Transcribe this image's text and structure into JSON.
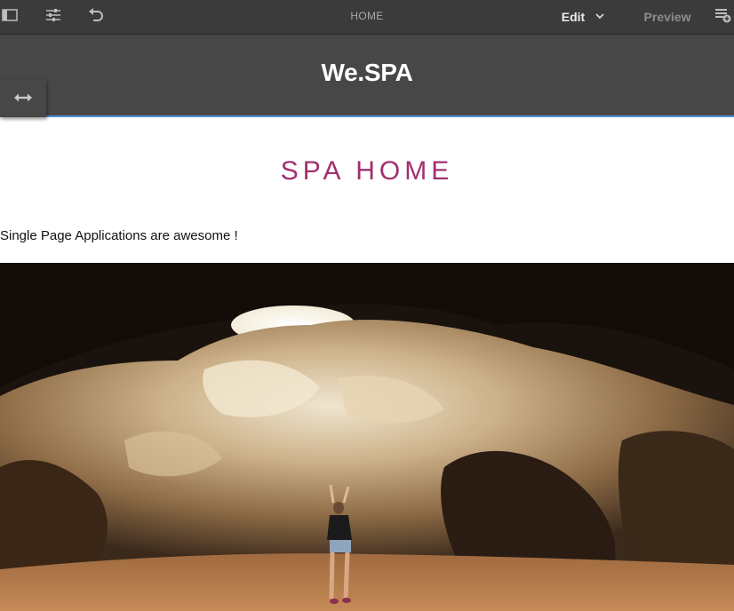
{
  "toolbar": {
    "title": "HOME",
    "mode_label": "Edit",
    "preview_label": "Preview",
    "icons": [
      "side-panel-icon",
      "page-properties-icon",
      "undo-icon",
      "chevron-down-icon",
      "annotations-icon"
    ]
  },
  "header": {
    "brand": "We.SPA",
    "toggle_icon": "left-right-arrow-icon"
  },
  "page": {
    "title": "SPA HOME",
    "text": "Single Page Applications are awesome !",
    "image_subject": "cave-photo"
  },
  "colors": {
    "toolbar_bg": "#3b3b3b",
    "header_bg": "#474747",
    "header_border": "#4f8fd8",
    "title": "#a0306f"
  }
}
